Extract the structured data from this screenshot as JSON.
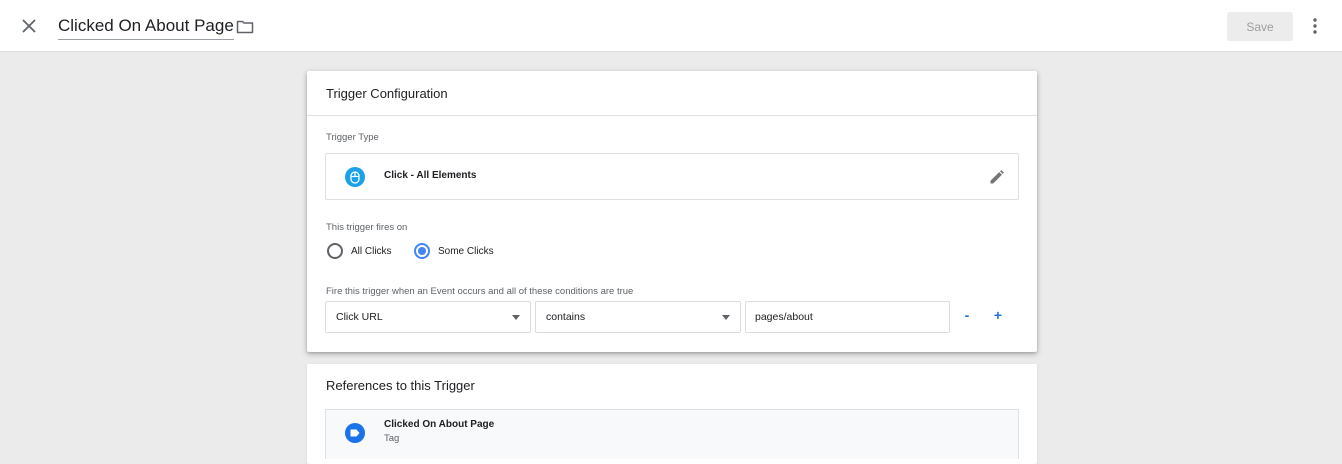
{
  "header": {
    "title": "Clicked On About Page",
    "save_label": "Save"
  },
  "icons": {
    "close": "close-icon",
    "folder": "folder-icon",
    "more": "more-vert-icon",
    "trigger_type": "mouse-icon",
    "edit": "pencil-icon",
    "reference": "tag-icon"
  },
  "colors": {
    "accent": "#4285f4",
    "link_blue": "#1a73e8",
    "click_icon": "#1aa1ea"
  },
  "config": {
    "title": "Trigger Configuration",
    "trigger_type_label": "Trigger Type",
    "trigger_type_value": "Click - All Elements",
    "fires_on_label": "This trigger fires on",
    "options": [
      {
        "label": "All Clicks",
        "checked": false
      },
      {
        "label": "Some Clicks",
        "checked": true
      }
    ],
    "conditions_label": "Fire this trigger when an Event occurs and all of these conditions are true",
    "condition": {
      "variable": "Click URL",
      "operator": "contains",
      "value": "pages/about"
    },
    "remove_label": "-",
    "add_label": "+"
  },
  "references": {
    "title": "References to this Trigger",
    "items": [
      {
        "name": "Clicked On About Page",
        "type": "Tag"
      }
    ]
  }
}
